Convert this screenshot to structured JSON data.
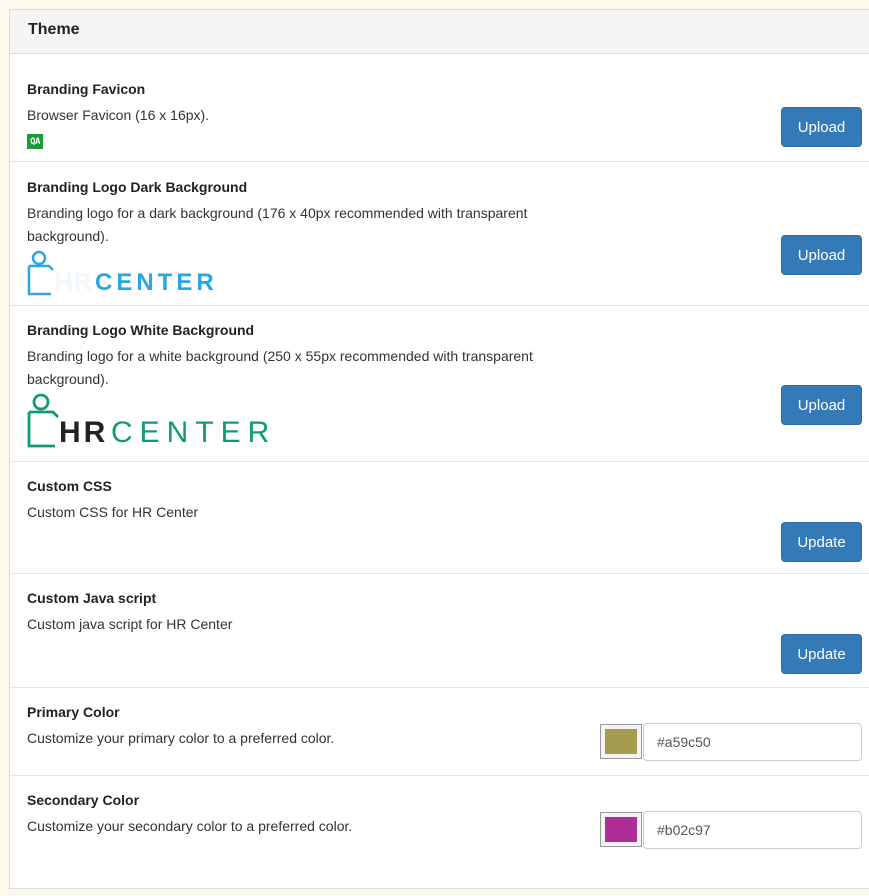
{
  "panel": {
    "title": "Theme"
  },
  "favicon": {
    "title": "Branding Favicon",
    "desc": "Browser Favicon (16 x 16px).",
    "preview_text": "QA",
    "button": "Upload"
  },
  "logo_dark": {
    "title": "Branding Logo Dark Background",
    "desc": "Branding logo for a dark background (176 x 40px recommended with transparent background).",
    "logo_hr": "HR",
    "logo_center": "CENTER",
    "button": "Upload"
  },
  "logo_white": {
    "title": "Branding Logo White Background",
    "desc": "Branding logo for a white background (250 x 55px recommended with transparent background).",
    "logo_hr": "HR",
    "logo_center": "CENTER",
    "button": "Upload"
  },
  "custom_css": {
    "title": "Custom CSS",
    "desc": "Custom CSS for HR Center",
    "button": "Update"
  },
  "custom_js": {
    "title": "Custom Java script",
    "desc": "Custom java script for HR Center",
    "button": "Update"
  },
  "primary_color": {
    "title": "Primary Color",
    "desc": "Customize your primary color to a preferred color.",
    "value": "#a59c50",
    "swatch": "#a59c50"
  },
  "secondary_color": {
    "title": "Secondary Color",
    "desc": "Customize your secondary color to a preferred color.",
    "value": "#b02c97",
    "swatch": "#b02c97"
  },
  "colors": {
    "button_primary": "#337ab7",
    "logo_dark_blue": "#29a8df",
    "logo_green": "#0f9b77"
  }
}
